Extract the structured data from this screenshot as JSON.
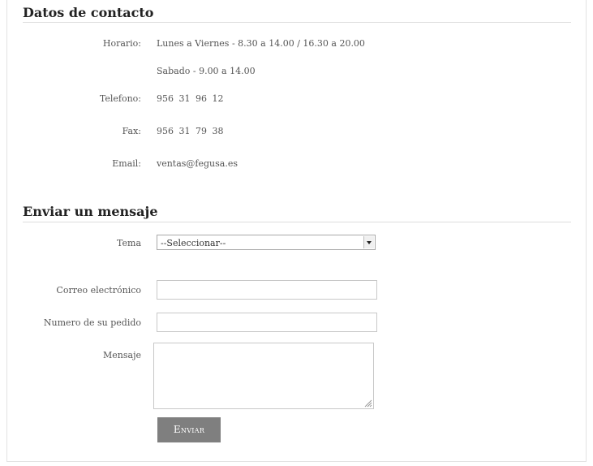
{
  "contact": {
    "heading": "Datos de contacto",
    "rows": [
      {
        "label": "Horario:",
        "value": "Lunes a Viernes - 8.30 a 14.00 / 16.30 a 20.00"
      },
      {
        "label": "",
        "value": "Sabado - 9.00 a 14.00"
      },
      {
        "label": "Telefono:",
        "value": "956 31 96 12"
      },
      {
        "label": "Fax:",
        "value": "956 31 79 38"
      },
      {
        "label": "Email:",
        "value": "ventas@fegusa.es"
      }
    ]
  },
  "message_form": {
    "heading": "Enviar un mensaje",
    "topic_label": "Tema",
    "topic_selected": "--Seleccionar--",
    "email_label": "Correo electrónico",
    "email_value": "",
    "order_label": "Numero de su pedido",
    "order_value": "",
    "message_label": "Mensaje",
    "message_value": "",
    "submit_label": "Enviar"
  }
}
